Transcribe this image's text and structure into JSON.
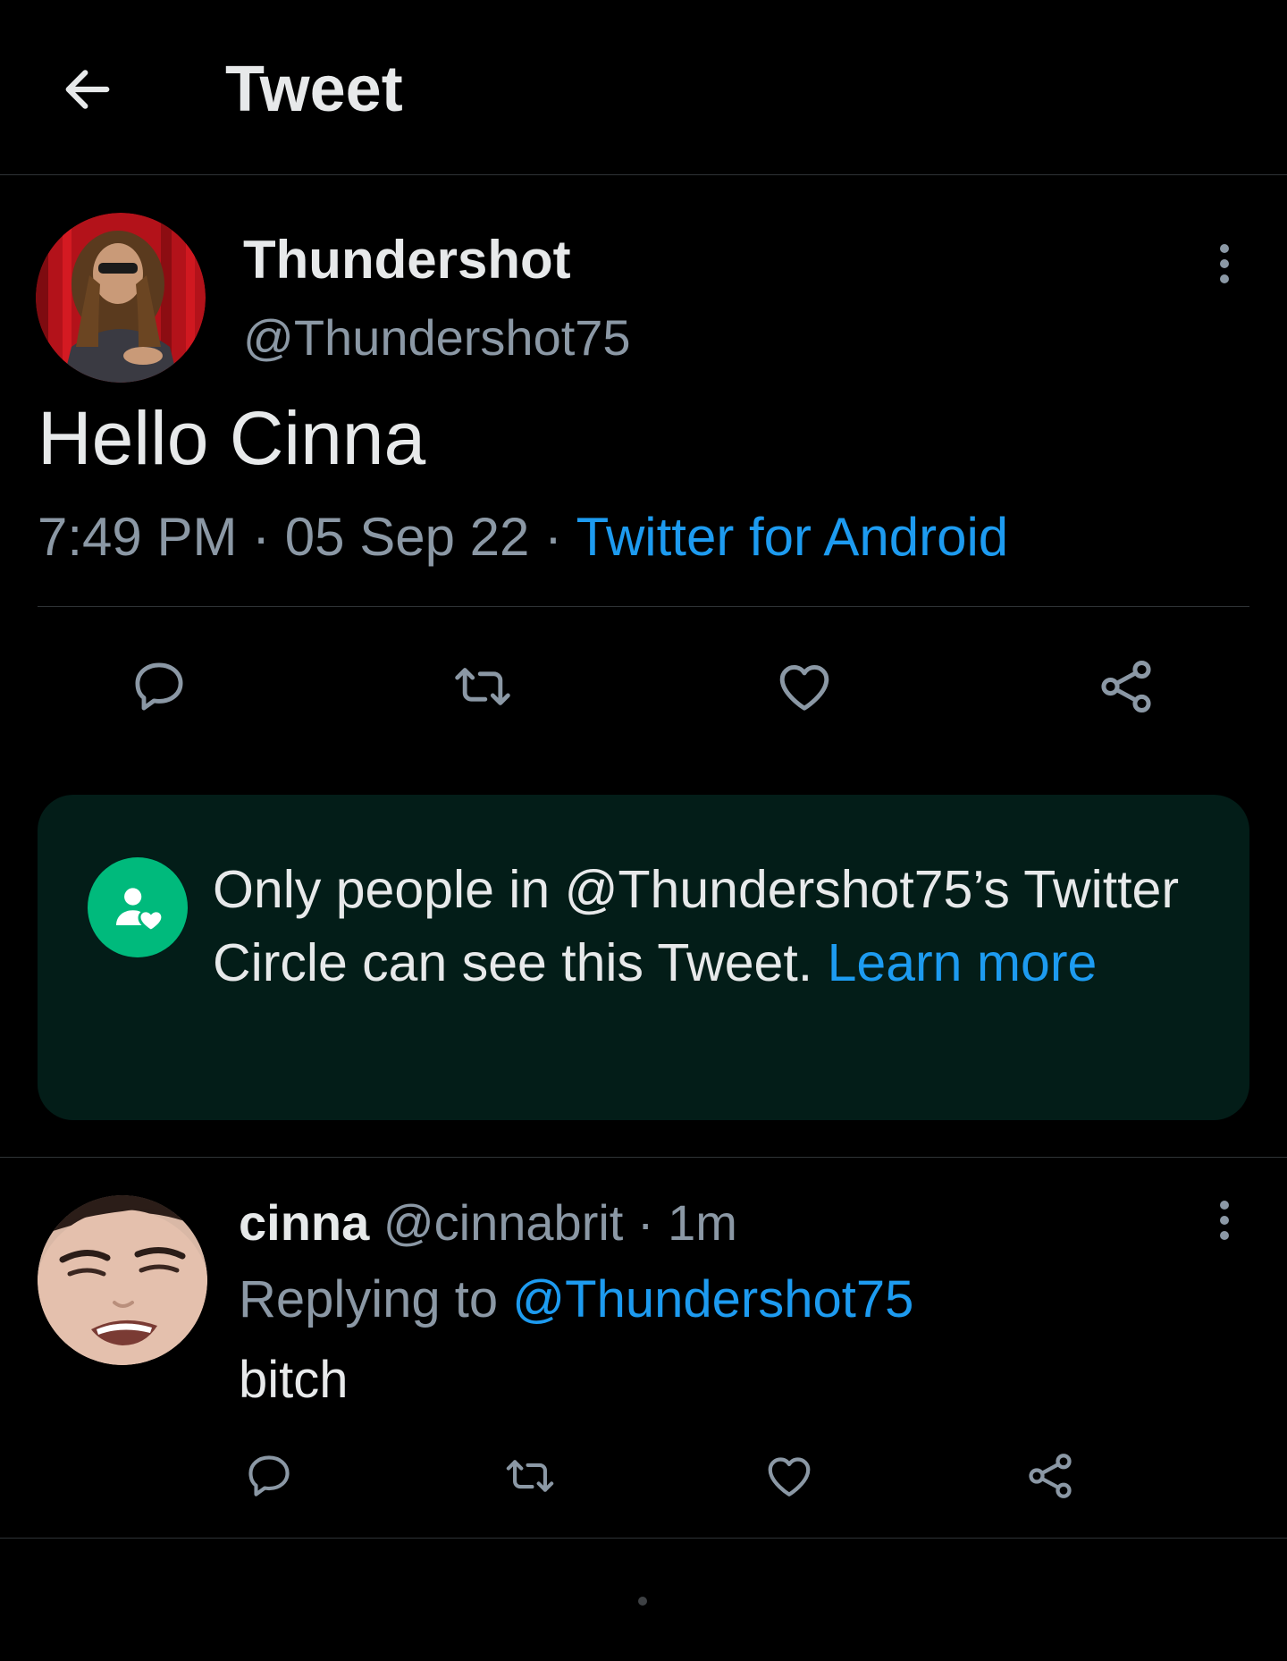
{
  "header": {
    "title": "Tweet",
    "back_icon": "arrow-left-icon"
  },
  "tweet": {
    "author": {
      "display_name": "Thundershot",
      "handle": "@Thundershot75"
    },
    "text": "Hello Cinna",
    "time": "7:49 PM",
    "separator": "·",
    "date": "05 Sep 22",
    "source": "Twitter for Android",
    "actions": [
      "reply-icon",
      "retweet-icon",
      "like-icon",
      "share-icon"
    ]
  },
  "circle_notice": {
    "text": "Only people in @Thundershot75’s Twitter Circle can see this Tweet.",
    "link": "Learn more",
    "badge_icon": "twitter-circle-icon",
    "badge_color": "#00ba7c",
    "background_color": "#031d18"
  },
  "reply": {
    "display_name": "cinna",
    "handle": "@cinnabrit",
    "separator": "·",
    "age": "1m",
    "replying_label": "Replying to",
    "replying_to": "@Thundershot75",
    "text": "bitch",
    "actions": [
      "reply-icon",
      "retweet-icon",
      "like-icon",
      "share-icon"
    ]
  },
  "colors": {
    "background": "#000000",
    "text_primary": "#e7e9ea",
    "text_secondary": "#8b98a5",
    "link": "#1d9bf0",
    "divider": "#2f3336"
  }
}
